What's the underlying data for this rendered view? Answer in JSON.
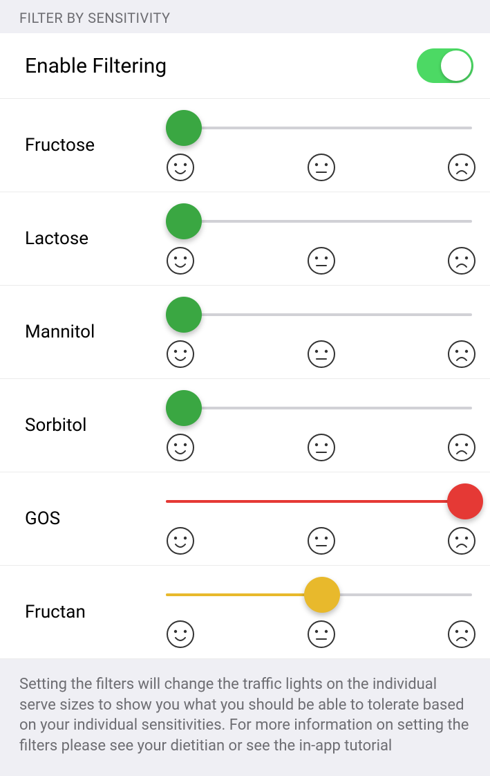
{
  "section_header": "FILTER BY SENSITIVITY",
  "enable": {
    "label": "Enable Filtering",
    "on": true
  },
  "levels": {
    "green": "#3aa742",
    "amber": "#e8b92c",
    "red": "#e53935"
  },
  "filters": [
    {
      "name": "Fructose",
      "value": 0,
      "color_key": "green"
    },
    {
      "name": "Lactose",
      "value": 0,
      "color_key": "green"
    },
    {
      "name": "Mannitol",
      "value": 0,
      "color_key": "green"
    },
    {
      "name": "Sorbitol",
      "value": 0,
      "color_key": "green"
    },
    {
      "name": "GOS",
      "value": 2,
      "color_key": "red"
    },
    {
      "name": "Fructan",
      "value": 1,
      "color_key": "amber"
    }
  ],
  "footer": "Setting the filters will change the traffic lights on the individual serve sizes to show you what you should be able to tolerate based on your individual sensitivities. For more information on setting the filters please see your dietitian or see the in-app tutorial"
}
